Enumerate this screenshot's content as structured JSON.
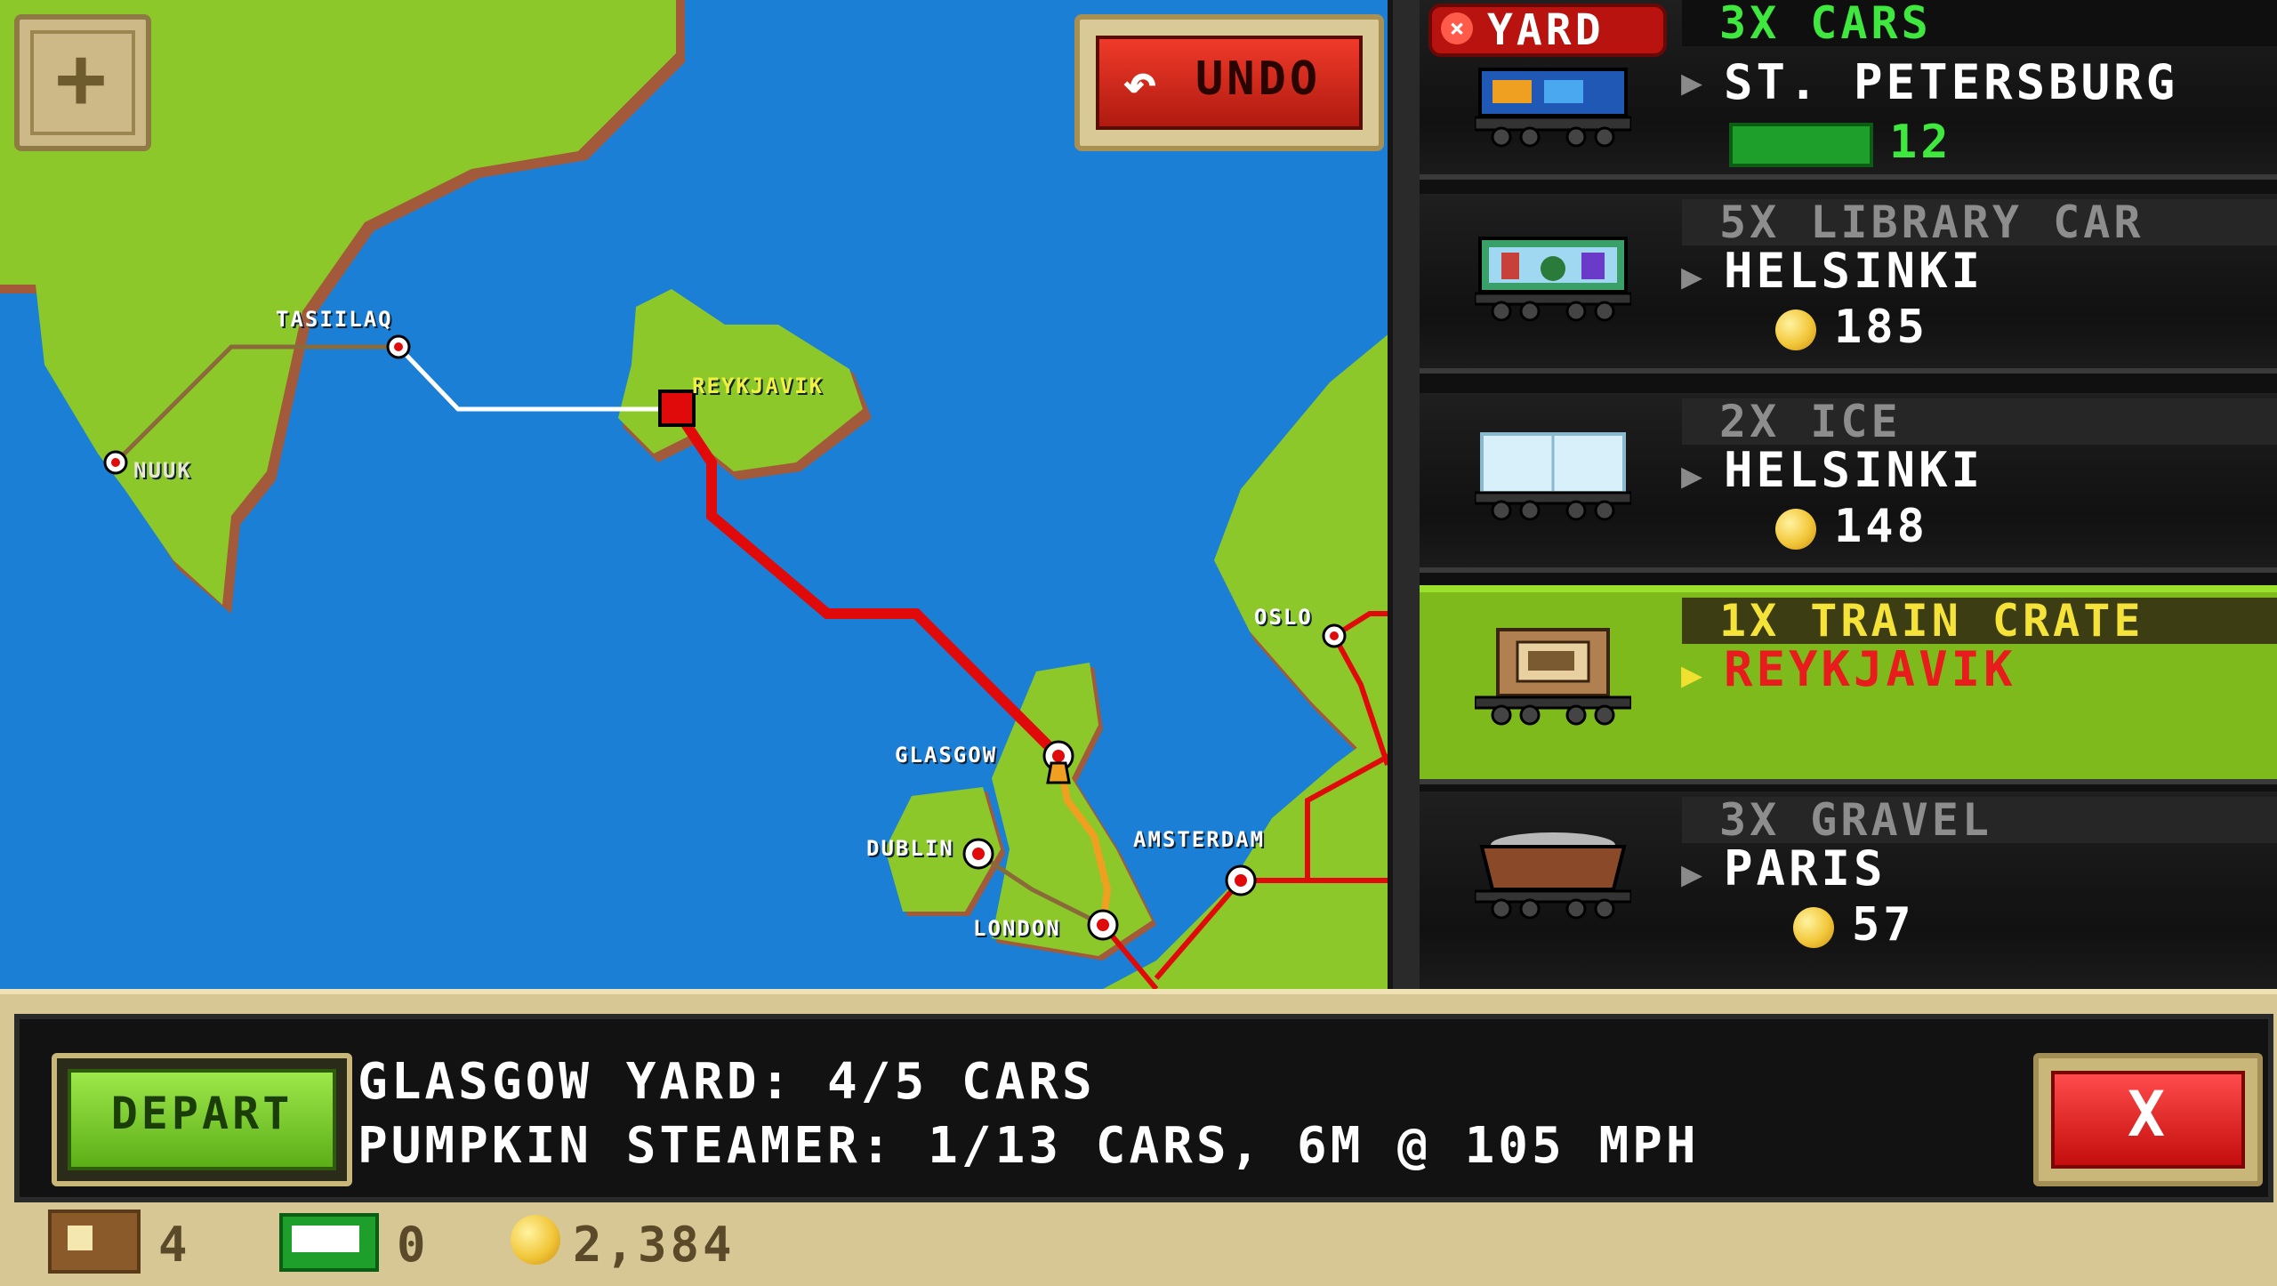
{
  "map": {
    "cities": [
      {
        "key": "tasiilaq",
        "label": "TASIILAQ"
      },
      {
        "key": "nuuk",
        "label": "NUUK"
      },
      {
        "key": "reykjavik",
        "label": "REYKJAVIK"
      },
      {
        "key": "oslo",
        "label": "OSLO"
      },
      {
        "key": "glasgow",
        "label": "GLASGOW"
      },
      {
        "key": "dublin",
        "label": "DUBLIN"
      },
      {
        "key": "amsterdam",
        "label": "AMSTERDAM"
      },
      {
        "key": "london",
        "label": "LONDON"
      }
    ],
    "undo_label": "UNDO",
    "zoom_icon": "plus-icon",
    "colors": {
      "sea": "#1c7fd6",
      "land": "#8cc82a",
      "route_active": "#e00a0a",
      "route_other": "#f0a020"
    }
  },
  "panel": {
    "yard_badge": "YARD",
    "cards": [
      {
        "qty_item": "3X CARS",
        "destination": "ST. PETERSBURG",
        "reward_type": "cash",
        "reward": "12",
        "selected": false
      },
      {
        "qty_item": "5X LIBRARY CAR",
        "destination": "HELSINKI",
        "reward_type": "coin",
        "reward": "185",
        "selected": false
      },
      {
        "qty_item": "2X ICE",
        "destination": "HELSINKI",
        "reward_type": "coin",
        "reward": "148",
        "selected": false
      },
      {
        "qty_item": "1X TRAIN CRATE",
        "destination": "REYKJAVIK",
        "reward_type": "none",
        "reward": "",
        "selected": true
      },
      {
        "qty_item": "3X GRAVEL",
        "destination": "PARIS",
        "reward_type": "coin",
        "reward": "57",
        "selected": false
      }
    ]
  },
  "bottom": {
    "depart_label": "DEPART",
    "line1": "GLASGOW YARD: 4/5 CARS",
    "line2": "PUMPKIN STEAMER: 1/13 CARS, 6M @ 105 MPH",
    "close_label": "X",
    "stats": {
      "crates": "4",
      "cash": "0",
      "coins": "2,384"
    }
  }
}
